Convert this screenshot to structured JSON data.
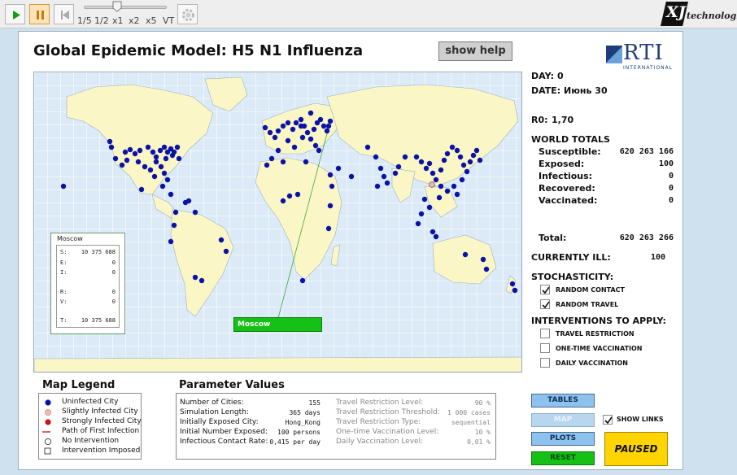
{
  "toolbar": {
    "speeds": [
      "1/5",
      "1/2",
      "x1",
      "x2",
      "x5",
      "VT"
    ],
    "brand": "technologies",
    "brand_mark": "XJ"
  },
  "title": "Global Epidemic Model: H5 N1 Influenza",
  "help_button": "show help",
  "logo": {
    "text": "RTI",
    "sub": "INTERNATIONAL"
  },
  "status": {
    "day_label": "DAY:",
    "day": "0",
    "date_label": "DATE:",
    "date": "Июнь 30",
    "r0_label": "R0:",
    "r0": "1,70"
  },
  "world_totals": {
    "heading": "WORLD TOTALS",
    "rows": [
      {
        "label": "Susceptible:",
        "value": "620 263 166"
      },
      {
        "label": "Exposed:",
        "value": "100"
      },
      {
        "label": "Infectious:",
        "value": "0"
      },
      {
        "label": "Recovered:",
        "value": "0"
      },
      {
        "label": "Vaccinated:",
        "value": "0"
      }
    ],
    "total_label": "Total:",
    "total": "620 263 266",
    "ill_label": "CURRENTLY ILL:",
    "ill": "100"
  },
  "stochasticity": {
    "heading": "STOCHASTICITY:",
    "items": [
      {
        "label": "RANDOM CONTACT",
        "checked": true
      },
      {
        "label": "RANDOM TRAVEL",
        "checked": true
      }
    ]
  },
  "interventions": {
    "heading": "INTERVENTIONS TO APPLY:",
    "items": [
      {
        "label": "TRAVEL RESTRICTION",
        "checked": false
      },
      {
        "label": "ONE-TIME VACCINATION",
        "checked": false
      },
      {
        "label": "DAILY VACCINATION",
        "checked": false
      }
    ]
  },
  "city_popup": {
    "name": "Moscow",
    "rows": [
      {
        "label": "S:",
        "value": "10 375 688"
      },
      {
        "label": "E:",
        "value": "0"
      },
      {
        "label": "I:",
        "value": "0"
      },
      {
        "label": "R:",
        "value": "0"
      },
      {
        "label": "V:",
        "value": "0"
      },
      {
        "label": "T:",
        "value": "10 375 688"
      }
    ],
    "tag": "Moscow"
  },
  "legend": {
    "heading": "Map Legend",
    "items": [
      {
        "label": "Uninfected City",
        "icon": "blue-dot-icon"
      },
      {
        "label": "Slightly Infected City",
        "icon": "light-red-dot-icon"
      },
      {
        "label": "Strongly Infected City",
        "icon": "red-dot-icon"
      },
      {
        "label": "Path of First Infection",
        "icon": "red-arrow-icon"
      },
      {
        "label": "No Intervention",
        "icon": "empty-circle-icon"
      },
      {
        "label": "Intervention Imposed",
        "icon": "square-icon"
      }
    ]
  },
  "parameters": {
    "heading": "Parameter Values",
    "left": [
      {
        "label": "Number of Cities:",
        "value": "155"
      },
      {
        "label": "Simulation Length:",
        "value": "365 days"
      },
      {
        "label": "Initially Exposed City:",
        "value": "Hong_Kong"
      },
      {
        "label": "Initial Number Exposed:",
        "value": "100 persons"
      },
      {
        "label": "Infectious Contact Rate:",
        "value": "0,415 per day"
      }
    ],
    "right": [
      {
        "label": "Travel Restriction Level:",
        "value": "90 %"
      },
      {
        "label": "Travel Restriction Threshold:",
        "value": "1 000 cases"
      },
      {
        "label": "Travel Restriction Type:",
        "value": "sequential"
      },
      {
        "label": "One-time Vaccination Level:",
        "value": "10 %"
      },
      {
        "label": "Daily Vaccination Level:",
        "value": "0,01 %"
      }
    ]
  },
  "controls": {
    "tables": "TABLES",
    "map": "MAP",
    "plots": "PLOTS",
    "reset": "RESET",
    "show_links": "SHOW LINKS",
    "show_links_checked": true,
    "state": "PAUSED"
  },
  "colors": {
    "uninfected": "#0b12a8",
    "slightly_infected": "#f2b8b0",
    "strongly_infected": "#d01010",
    "land": "#fbf6c6",
    "ocean": "#dbeaf6",
    "reset_green": "#14c114",
    "paused_yellow": "#ffd400"
  }
}
